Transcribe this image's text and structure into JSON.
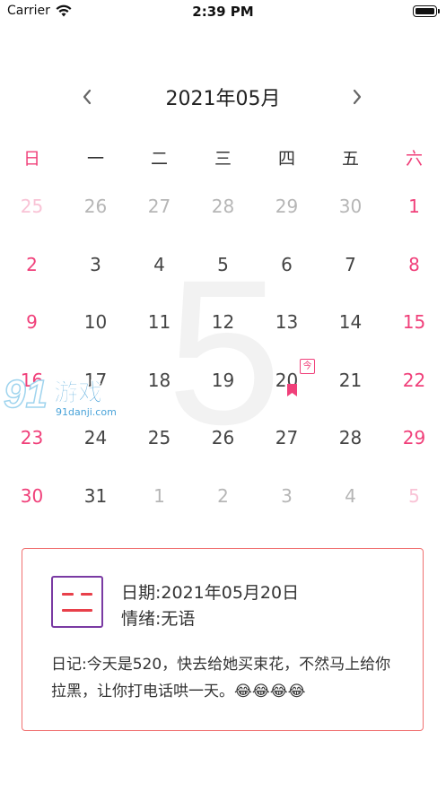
{
  "status_bar": {
    "carrier": "Carrier",
    "time": "2:39 PM"
  },
  "calendar": {
    "title": "2021年05月",
    "big_month": "5",
    "weekdays": [
      "日",
      "一",
      "二",
      "三",
      "四",
      "五",
      "六"
    ],
    "today_badge": "今",
    "weeks": [
      [
        [
          "25",
          false
        ],
        [
          "26",
          false
        ],
        [
          "27",
          false
        ],
        [
          "28",
          false
        ],
        [
          "29",
          false
        ],
        [
          "30",
          false
        ],
        [
          "1",
          true
        ]
      ],
      [
        [
          "2",
          true
        ],
        [
          "3",
          true
        ],
        [
          "4",
          true
        ],
        [
          "5",
          true
        ],
        [
          "6",
          true
        ],
        [
          "7",
          true
        ],
        [
          "8",
          true
        ]
      ],
      [
        [
          "9",
          true
        ],
        [
          "10",
          true
        ],
        [
          "11",
          true
        ],
        [
          "12",
          true
        ],
        [
          "13",
          true
        ],
        [
          "14",
          true
        ],
        [
          "15",
          true
        ]
      ],
      [
        [
          "16",
          true
        ],
        [
          "17",
          true
        ],
        [
          "18",
          true
        ],
        [
          "19",
          true
        ],
        [
          "20",
          true
        ],
        [
          "21",
          true
        ],
        [
          "22",
          true
        ]
      ],
      [
        [
          "23",
          true
        ],
        [
          "24",
          true
        ],
        [
          "25",
          true
        ],
        [
          "26",
          true
        ],
        [
          "27",
          true
        ],
        [
          "28",
          true
        ],
        [
          "29",
          true
        ]
      ],
      [
        [
          "30",
          true
        ],
        [
          "31",
          true
        ],
        [
          "1",
          false
        ],
        [
          "2",
          false
        ],
        [
          "3",
          false
        ],
        [
          "4",
          false
        ],
        [
          "5",
          false
        ]
      ]
    ]
  },
  "watermark": {
    "brand": "游戏",
    "site": "91danji.com"
  },
  "diary_card": {
    "date": "日期:2021年05月20日",
    "mood": "情绪:无语",
    "content": "日记:今天是520，快去给她买束花，不然马上给你拉黑，让你打电话哄一天。😂😂😂😂"
  },
  "colors": {
    "accent": "#f0407a",
    "card_border": "#f07070",
    "mood_icon_border": "#7a3aa3"
  }
}
